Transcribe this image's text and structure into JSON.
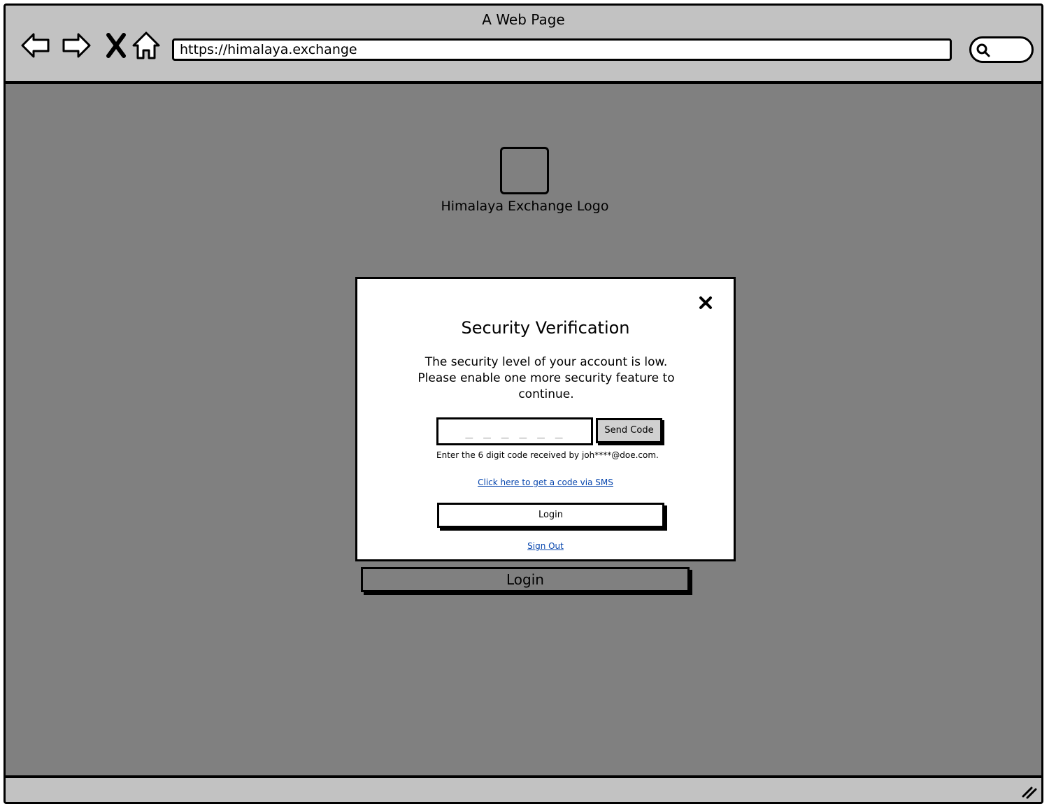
{
  "browser": {
    "title": "A Web Page",
    "url": "https://himalaya.exchange",
    "nav_icons": [
      "back-arrow-icon",
      "forward-arrow-icon",
      "stop-icon",
      "home-icon"
    ],
    "search_icon": "search-icon"
  },
  "page": {
    "logo_caption": "Himalaya Exchange Logo",
    "login_button": "Login"
  },
  "modal": {
    "title": "Security Verification",
    "message": "The security level of your account is low. Please enable one more security feature to continue.",
    "code_placeholder": "_ _ _ _ _ _",
    "send_code_label": "Send Code",
    "code_hint": "Enter the 6 digit code received by joh****@doe.com.",
    "sms_link": "Click here to get a code via SMS",
    "login_label": "Login",
    "sign_out_label": "Sign Out"
  },
  "colors": {
    "chrome": "#c2c2c2",
    "backdrop": "#808080",
    "link": "#0645ad"
  }
}
